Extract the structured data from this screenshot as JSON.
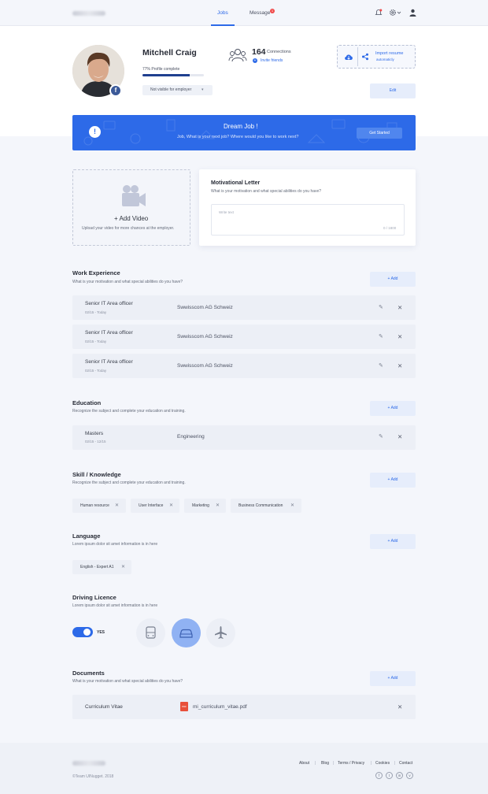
{
  "nav": {
    "jobs": "Jobs",
    "message": "Message",
    "message_badge": "1"
  },
  "profile": {
    "name": "Mitchell Craig",
    "completion_text": "77%  Profile complete",
    "completion_pct": 77,
    "visibility": "Not visible for employer",
    "connections_count": "164",
    "connections_label": "Connections",
    "invite": "Invite friends",
    "import_title": "Import resume",
    "import_sub": "automaticly",
    "edit": "Edit"
  },
  "banner": {
    "title": "Dream Job !",
    "subtitle": "Job, What is your next job? Where would  you like to work next?",
    "button": "Get Started"
  },
  "video": {
    "title": "+ Add Video",
    "subtitle": "Upload your video for more chances at the employer."
  },
  "letter": {
    "title": "Motivational Letter",
    "subtitle": "What is your motivation and what special abilities do you have?",
    "placeholder": "Write text",
    "counter": "0 / 1800"
  },
  "work": {
    "title": "Work Experience",
    "subtitle": "What is your motivation and what special abilities do you have?",
    "add": "+ Add",
    "items": [
      {
        "title": "Senior IT Area officer",
        "date": "02/15 - Today",
        "company": "Swwisscom AG Schweiz"
      },
      {
        "title": "Senior IT Area officer",
        "date": "02/15 - Today",
        "company": "Swwisscom AG Schweiz"
      },
      {
        "title": "Senior IT Area officer",
        "date": "02/15 - Today",
        "company": "Swwisscom AG Schweiz"
      }
    ]
  },
  "education": {
    "title": "Education",
    "subtitle": "Recognize the subject and complete your education and training.",
    "add": "+ Add",
    "items": [
      {
        "title": "Masters",
        "date": "02/15 - 12/15",
        "company": "Engineering"
      }
    ]
  },
  "skills": {
    "title": "Skill / Knowledge",
    "subtitle": "Recognize the subject and complete your education and training.",
    "add": "+ Add",
    "tags": [
      "Human resource",
      "User Interface",
      "Marketing",
      "Business Communication"
    ]
  },
  "language": {
    "title": "Language",
    "subtitle": "Lorem ipsum dolor sit amet information is in here",
    "add": "+ Add",
    "tags": [
      "English - Expert A1"
    ]
  },
  "driving": {
    "title": "Driving Licence",
    "subtitle": "Lorem ipsum dolor sit amet information is in here",
    "toggle_label": "YES",
    "vehicles": [
      "bus-icon",
      "car-icon",
      "plane-icon"
    ],
    "selected": "car-icon"
  },
  "documents": {
    "title": "Documents",
    "subtitle": "What is your motivation and what special abilities do you have?",
    "add": "+ Add",
    "items": [
      {
        "title": "Curriculum Vitae",
        "badge": "PDF",
        "file": "mi_curriculum_vitae.pdf"
      }
    ]
  },
  "footer": {
    "links": [
      "About",
      "Blog",
      "Terms / Privacy",
      "Cookies",
      "Contact"
    ],
    "copyright": "©Team UINugget. 2018",
    "social": [
      "f",
      "t",
      "in",
      "v"
    ]
  },
  "colors": {
    "primary": "#2d6ae8",
    "bg": "#f4f6fb",
    "danger": "#f04a4a"
  }
}
